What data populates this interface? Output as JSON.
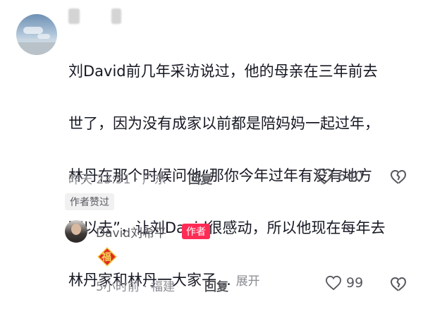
{
  "comment": {
    "text_lines": [
      "刘David前几年采访说过，他的母亲在三年前去",
      "世了，因为没有成家以前都是陪妈妈一起过年，",
      "林丹在那个时候问他“那你今年过年有没有地方",
      "可以去”，让刘David很感动，所以他现在每年去",
      "林丹家和林丹一大家子…"
    ],
    "expand_label": "展开",
    "time_location": "昨天 23:51 · 广东",
    "reply_label": "回复",
    "like_count": "640",
    "author_liked_badge": "作者赞过"
  },
  "reply": {
    "username": "David刘希平",
    "author_badge": "作者",
    "sticker_char": "福",
    "time_location": "5小时前 · 福建",
    "reply_label": "回复",
    "like_count": "99"
  },
  "colors": {
    "accent": "#fe2c55",
    "text_primary": "#161823",
    "text_secondary": "#8a8b91"
  }
}
